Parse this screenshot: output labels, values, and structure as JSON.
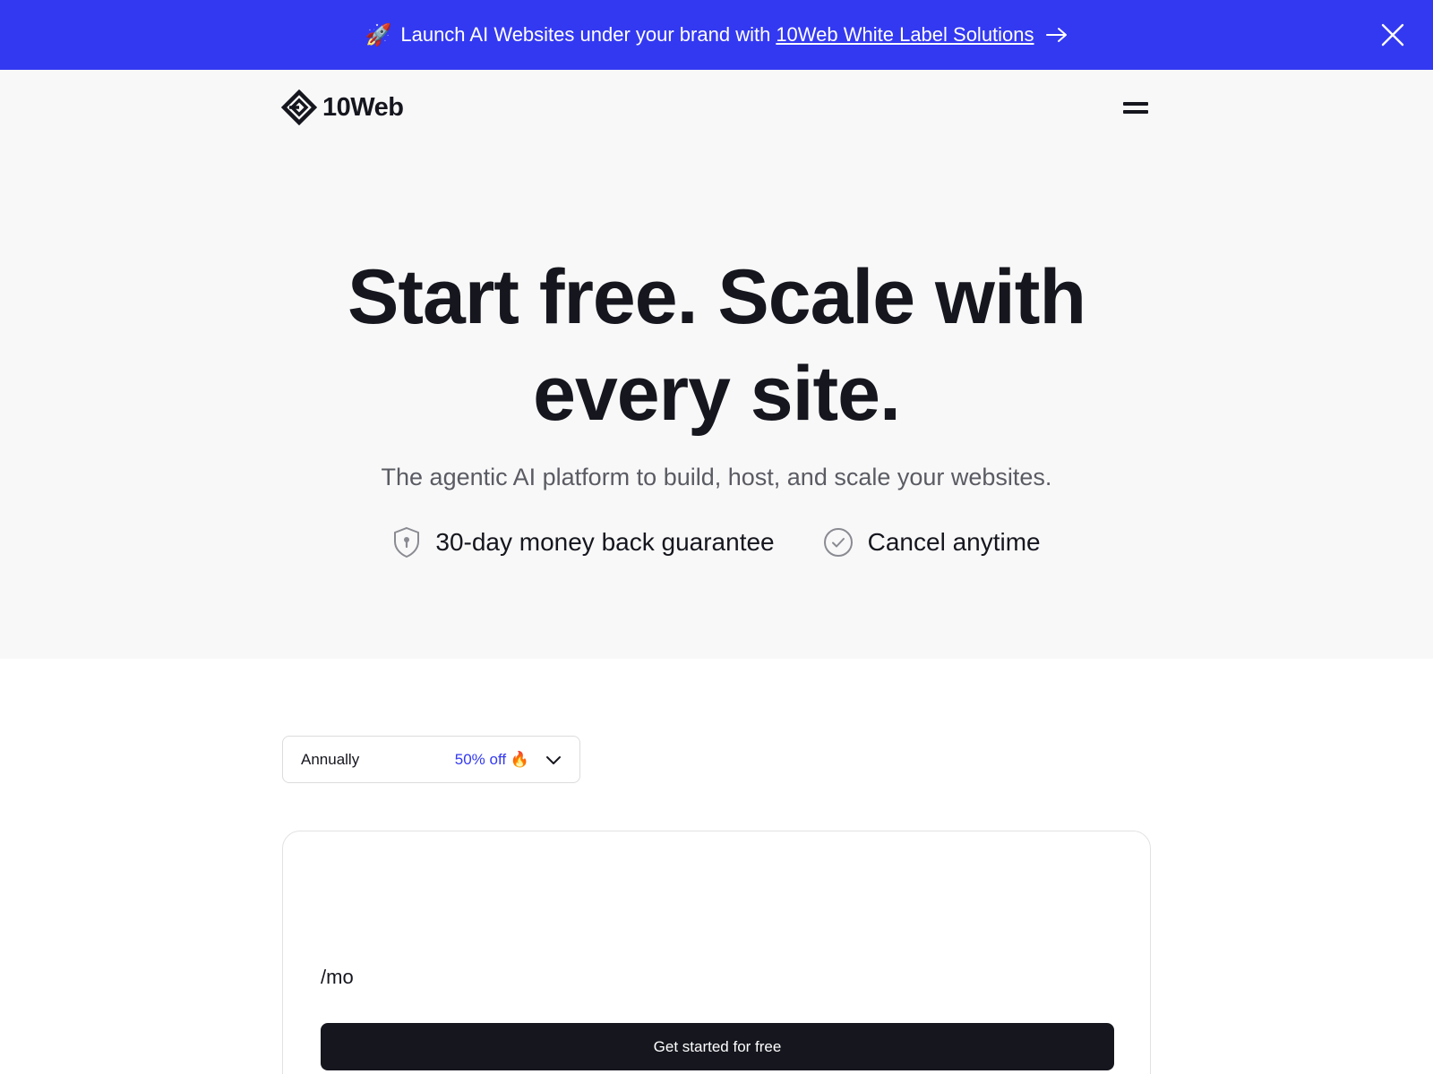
{
  "promo": {
    "rocket": "🚀",
    "text": "Launch AI Websites under your brand with",
    "link": "10Web White Label Solutions"
  },
  "nav": {
    "logo_text": "10Web"
  },
  "hero": {
    "title_line1": "Start free. Scale with",
    "title_line2": "every site.",
    "subtitle": "The agentic AI platform to build, host, and scale your websites.",
    "badges": [
      {
        "icon": "shield-icon",
        "label": "30-day money back guarantee"
      },
      {
        "icon": "check-circle-icon",
        "label": "Cancel anytime"
      }
    ]
  },
  "billing": {
    "selected": "Annually",
    "discount": "50% off",
    "discount_emoji": "🔥"
  },
  "plan": {
    "per_month": "/mo",
    "cta": "Get started for free"
  },
  "colors": {
    "brand_blue": "#3339f1",
    "dark": "#15161e",
    "hero_bg": "#f8f8f8"
  }
}
